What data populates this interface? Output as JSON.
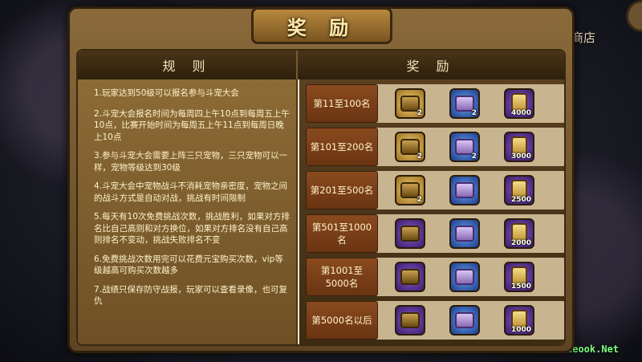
{
  "title": "奖 励",
  "shop_label": "商店",
  "watermark": "Eeook.Net",
  "columns": {
    "rules": "规 则",
    "rewards": "奖 励"
  },
  "rules": [
    "1.玩家达到50级可以报名参与斗宠大会",
    "2.斗宠大会报名时间为每周四上午10点到每周五上午10点，比赛开始时间为每周五上午11点到每周日晚上10点",
    "3.参与斗宠大会需要上阵三只宠物，三只宠物可以一样，宠物等级达到30级",
    "4.斗宠大会中宠物战斗不消耗宠物亲密度，宠物之间的战斗方式是自动对战，挑战有时间限制",
    "5.每天有10次免费挑战次数，挑战胜利，如果对方排名比自己高则和对方换位，如果对方排名没有自己高则排名不变动，挑战失败排名不变",
    "6.免费挑战次数用完可以花费元宝购买次数，vip等级越高可购买次数越多",
    "7.战绩只保存防守战报，玩家可以查看录像，也可复仇"
  ],
  "rewards": [
    {
      "rank": "第11至100名",
      "items": [
        {
          "icon": "gold-chest-icon",
          "frame": "gold",
          "count": "2"
        },
        {
          "icon": "gift-box-icon",
          "frame": "blue",
          "count": "2"
        },
        {
          "icon": "token-icon",
          "frame": "purple",
          "count": "4000"
        }
      ]
    },
    {
      "rank": "第101至200名",
      "items": [
        {
          "icon": "gold-chest-icon",
          "frame": "gold",
          "count": "2"
        },
        {
          "icon": "gift-box-icon",
          "frame": "blue",
          "count": "2"
        },
        {
          "icon": "token-icon",
          "frame": "purple",
          "count": "3000"
        }
      ]
    },
    {
      "rank": "第201至500名",
      "items": [
        {
          "icon": "gold-chest-icon",
          "frame": "gold",
          "count": "2"
        },
        {
          "icon": "gift-box-icon",
          "frame": "blue",
          "count": ""
        },
        {
          "icon": "token-icon",
          "frame": "purple",
          "count": "2500"
        }
      ]
    },
    {
      "rank": "第501至1000名",
      "items": [
        {
          "icon": "bronze-chest-icon",
          "frame": "purple",
          "count": ""
        },
        {
          "icon": "gift-box-icon",
          "frame": "blue",
          "count": ""
        },
        {
          "icon": "token-icon",
          "frame": "purple",
          "count": "2000"
        }
      ]
    },
    {
      "rank": "第1001至5000名",
      "items": [
        {
          "icon": "bronze-chest-icon",
          "frame": "purple",
          "count": ""
        },
        {
          "icon": "gift-box-icon",
          "frame": "blue",
          "count": ""
        },
        {
          "icon": "token-icon",
          "frame": "purple",
          "count": "1500"
        }
      ]
    },
    {
      "rank": "第5000名以后",
      "items": [
        {
          "icon": "bronze-chest-icon",
          "frame": "purple",
          "count": ""
        },
        {
          "icon": "gift-box-icon",
          "frame": "blue",
          "count": ""
        },
        {
          "icon": "token-icon",
          "frame": "purple",
          "count": "1000"
        }
      ]
    }
  ]
}
